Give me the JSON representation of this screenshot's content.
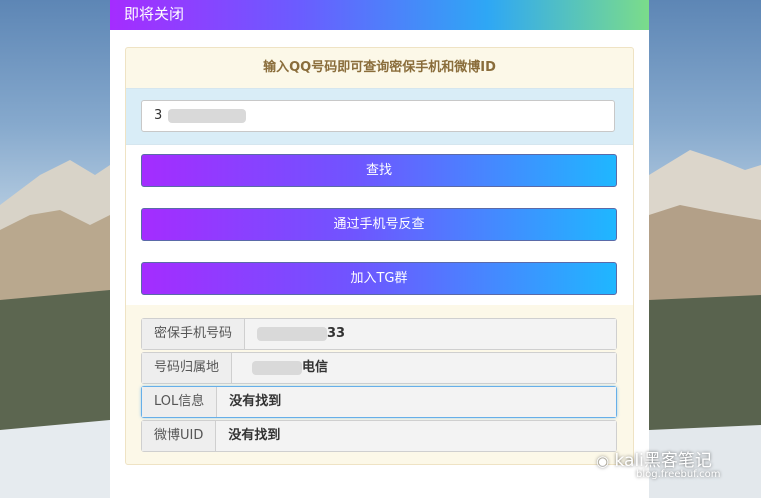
{
  "modal": {
    "close_label": "即将关闭"
  },
  "panel": {
    "title": "输入QQ号码即可查询密保手机和微博ID"
  },
  "qq_input": {
    "value_prefix": "3"
  },
  "buttons": {
    "search": "查找",
    "reverse_by_phone": "通过手机号反查",
    "join_tg": "加入TG群"
  },
  "results": [
    {
      "label": "密保手机号码",
      "value": "33"
    },
    {
      "label": "号码归属地",
      "value": "电信"
    },
    {
      "label": "LOL信息",
      "value": "没有找到"
    },
    {
      "label": "微博UID",
      "value": "没有找到"
    }
  ],
  "watermark": {
    "line1": "kali黑客笔记",
    "line2": "blog.freebuf.com"
  },
  "colors": {
    "gradient_start": "#a52cff",
    "gradient_end": "#1fb7ff",
    "panel_title": "#8a6d3b",
    "input_band": "#d9edf7"
  }
}
